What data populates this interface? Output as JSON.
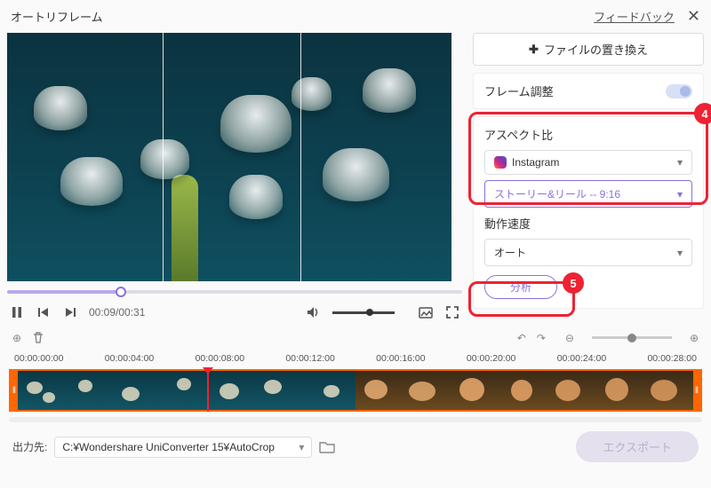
{
  "header": {
    "title": "オートリフレーム",
    "feedback": "フィードバック"
  },
  "preview": {
    "time": "00:09/00:31"
  },
  "panel": {
    "replace_label": "ファイルの置き換え",
    "frame_adjust": "フレーム調整",
    "aspect_title": "アスペクト比",
    "platform_selected": "Instagram",
    "ratio_selected": "ストーリー&リール -- 9:16",
    "speed_title": "動作速度",
    "speed_selected": "オート",
    "analyze": "分析",
    "callout4": "4",
    "callout5": "5"
  },
  "ruler": [
    "00:00:00:00",
    "00:00:04:00",
    "00:00:08:00",
    "00:00:12:00",
    "00:00:16:00",
    "00:00:20:00",
    "00:00:24:00",
    "00:00:28:00"
  ],
  "footer": {
    "label": "出力先:",
    "path": "C:¥Wondershare UniConverter 15¥AutoCrop",
    "export": "エクスポート"
  }
}
